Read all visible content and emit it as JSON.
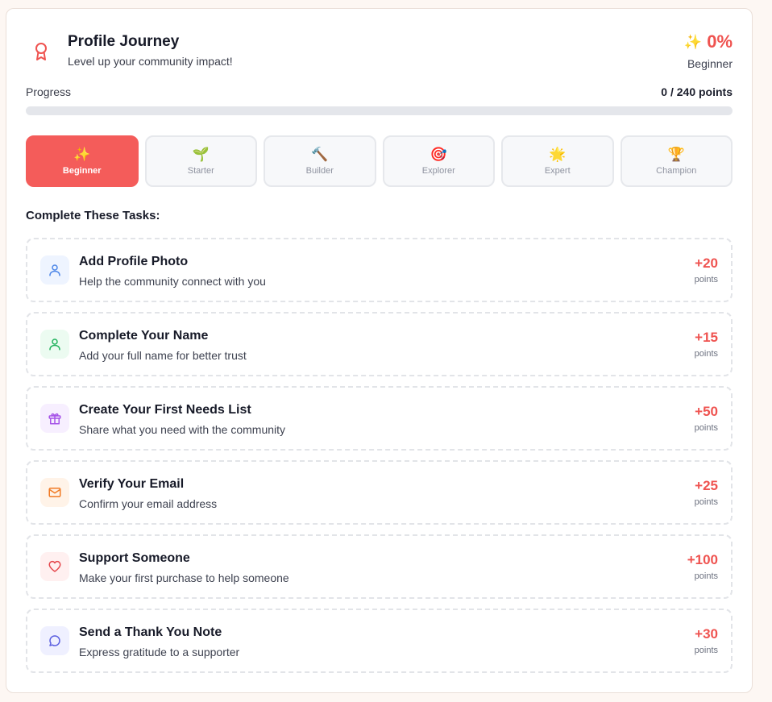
{
  "header": {
    "title": "Profile Journey",
    "subtitle": "Level up your community impact!",
    "percent": "0%",
    "level": "Beginner",
    "sparkle_icon": "✨"
  },
  "progress": {
    "label": "Progress",
    "points_text": "0 / 240 points",
    "value": 0
  },
  "levels": [
    {
      "emoji": "✨",
      "label": "Beginner",
      "active": true
    },
    {
      "emoji": "🌱",
      "label": "Starter",
      "active": false
    },
    {
      "emoji": "🔨",
      "label": "Builder",
      "active": false
    },
    {
      "emoji": "🎯",
      "label": "Explorer",
      "active": false
    },
    {
      "emoji": "🌟",
      "label": "Expert",
      "active": false
    },
    {
      "emoji": "🏆",
      "label": "Champion",
      "active": false
    }
  ],
  "tasks_heading": "Complete These Tasks:",
  "tasks": [
    {
      "icon": "user-icon",
      "title": "Add Profile Photo",
      "description": "Help the community connect with you",
      "points": "+20",
      "points_unit": "points",
      "icon_color": "#4c86e8",
      "icon_bg": "#eef4ff"
    },
    {
      "icon": "user-check-icon",
      "title": "Complete Your Name",
      "description": "Add your full name for better trust",
      "points": "+15",
      "points_unit": "points",
      "icon_color": "#22b35e",
      "icon_bg": "#ecfbf1"
    },
    {
      "icon": "gift-icon",
      "title": "Create Your First Needs List",
      "description": "Share what you need with the community",
      "points": "+50",
      "points_unit": "points",
      "icon_color": "#a654e8",
      "icon_bg": "#f7efff"
    },
    {
      "icon": "mail-icon",
      "title": "Verify Your Email",
      "description": "Confirm your email address",
      "points": "+25",
      "points_unit": "points",
      "icon_color": "#f07a24",
      "icon_bg": "#fff3e8"
    },
    {
      "icon": "heart-icon",
      "title": "Support Someone",
      "description": "Make your first purchase to help someone",
      "points": "+100",
      "points_unit": "points",
      "icon_color": "#e5484d",
      "icon_bg": "#fff0f0"
    },
    {
      "icon": "message-circle-icon",
      "title": "Send a Thank You Note",
      "description": "Express gratitude to a supporter",
      "points": "+30",
      "points_unit": "points",
      "icon_color": "#5b5fe0",
      "icon_bg": "#eff0ff"
    }
  ],
  "colors": {
    "accent": "#ef5350"
  }
}
